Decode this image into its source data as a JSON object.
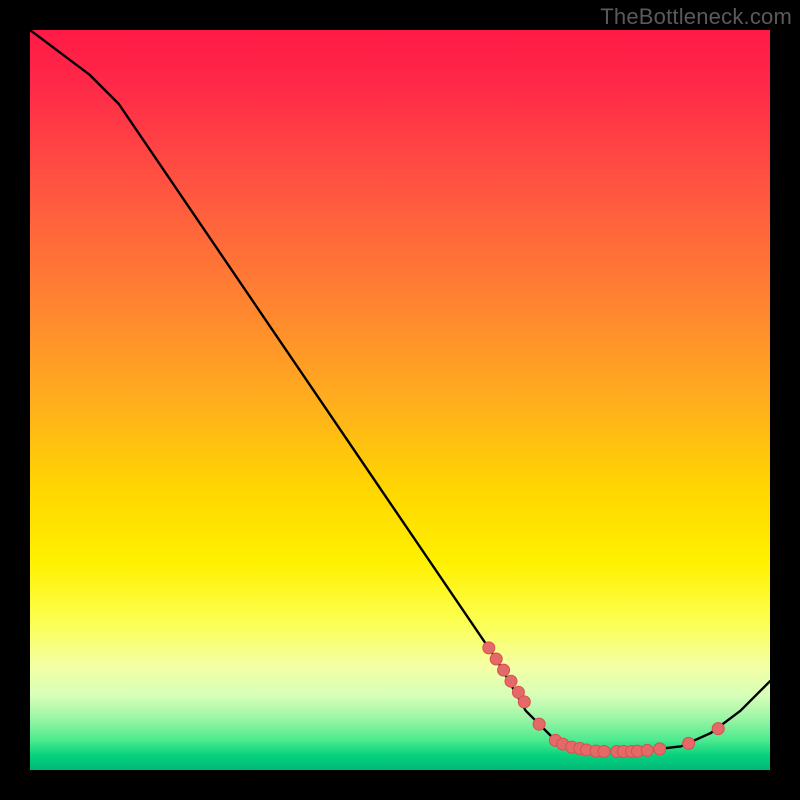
{
  "watermark": "TheBottleneck.com",
  "chart_data": {
    "type": "line",
    "title": "",
    "xlabel": "",
    "ylabel": "",
    "xlim": [
      0,
      100
    ],
    "ylim": [
      0,
      100
    ],
    "grid": false,
    "curve": [
      {
        "x": 0,
        "y": 100
      },
      {
        "x": 8,
        "y": 94
      },
      {
        "x": 12,
        "y": 90
      },
      {
        "x": 63,
        "y": 15
      },
      {
        "x": 67,
        "y": 8
      },
      {
        "x": 71,
        "y": 4
      },
      {
        "x": 76,
        "y": 2.5
      },
      {
        "x": 82,
        "y": 2.5
      },
      {
        "x": 88,
        "y": 3.2
      },
      {
        "x": 92,
        "y": 5
      },
      {
        "x": 96,
        "y": 8
      },
      {
        "x": 100,
        "y": 12
      }
    ],
    "markers": [
      {
        "x": 62.0,
        "y": 16.5
      },
      {
        "x": 63.0,
        "y": 15.0
      },
      {
        "x": 64.0,
        "y": 13.5
      },
      {
        "x": 65.0,
        "y": 12.0
      },
      {
        "x": 66.0,
        "y": 10.5
      },
      {
        "x": 66.8,
        "y": 9.2
      },
      {
        "x": 68.8,
        "y": 6.2
      },
      {
        "x": 71.0,
        "y": 4.0
      },
      {
        "x": 72.0,
        "y": 3.5
      },
      {
        "x": 73.2,
        "y": 3.1
      },
      {
        "x": 74.3,
        "y": 2.9
      },
      {
        "x": 75.2,
        "y": 2.7
      },
      {
        "x": 76.5,
        "y": 2.55
      },
      {
        "x": 77.6,
        "y": 2.5
      },
      {
        "x": 79.3,
        "y": 2.5
      },
      {
        "x": 80.2,
        "y": 2.5
      },
      {
        "x": 81.3,
        "y": 2.5
      },
      {
        "x": 82.1,
        "y": 2.55
      },
      {
        "x": 83.4,
        "y": 2.65
      },
      {
        "x": 85.1,
        "y": 2.85
      },
      {
        "x": 89.0,
        "y": 3.6
      },
      {
        "x": 93.0,
        "y": 5.6
      }
    ],
    "colors": {
      "curve": "#000000",
      "marker_fill": "#e46a6a",
      "marker_stroke": "#d94f4f"
    }
  }
}
